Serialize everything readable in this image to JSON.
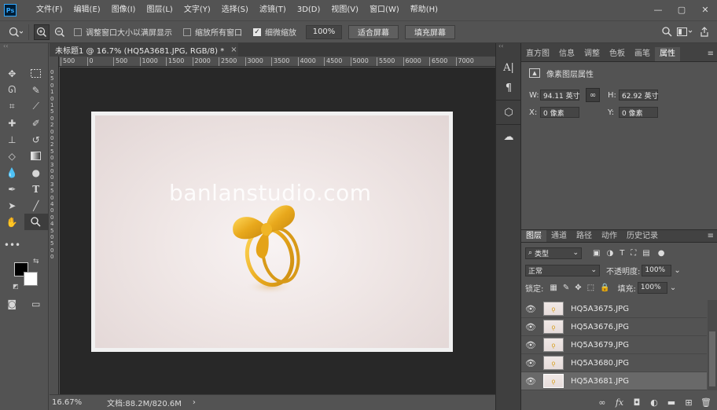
{
  "app": {
    "logo_text": "Ps"
  },
  "menu": [
    "文件(F)",
    "编辑(E)",
    "图像(I)",
    "图层(L)",
    "文字(Y)",
    "选择(S)",
    "滤镜(T)",
    "3D(D)",
    "视图(V)",
    "窗口(W)",
    "帮助(H)"
  ],
  "window_controls": {
    "minimize": "—",
    "maximize": "▢",
    "close": "✕"
  },
  "options": {
    "resize_windows": {
      "label": "调整窗口大小以满屏显示",
      "checked": false
    },
    "zoom_all": {
      "label": "缩放所有窗口",
      "checked": false
    },
    "scrubby_zoom": {
      "label": "细微缩放",
      "checked": true
    },
    "zoom_value": "100%",
    "fit_screen": "适合屏幕",
    "fill_screen": "填充屏幕"
  },
  "document": {
    "tab_title": "未标题1 @ 16.7% (HQ5A3681.JPG, RGB/8) *",
    "tab_close": "×",
    "ruler_h": [
      "500",
      "0",
      "500",
      "1000",
      "1500",
      "2000",
      "2500",
      "3000",
      "3500",
      "4000",
      "4500",
      "5000",
      "5500",
      "6000",
      "6500",
      "7000"
    ],
    "ruler_v": [
      "0",
      "5",
      "0",
      "1",
      "0",
      "1",
      "5",
      "0",
      "2",
      "0",
      "0",
      "2",
      "5",
      "0",
      "3",
      "0",
      "0",
      "3",
      "5",
      "0",
      "4",
      "0",
      "0",
      "4",
      "5",
      "0",
      "5",
      "0",
      "0"
    ],
    "watermark": "banlanstudio.com"
  },
  "status": {
    "zoom": "16.67%",
    "doc_size": "文档:88.2M/820.6M",
    "arrow": "›"
  },
  "properties_panel": {
    "tabs": [
      "直方图",
      "信息",
      "调整",
      "色板",
      "画笔",
      "属性"
    ],
    "active_tab": "属性",
    "title": "像素图层属性",
    "w_label": "W:",
    "w_value": "94.11 英寸",
    "h_label": "H:",
    "h_value": "62.92 英寸",
    "x_label": "X:",
    "x_value": "0 像素",
    "y_label": "Y:",
    "y_value": "0 像素"
  },
  "layers_panel": {
    "tabs": [
      "图层",
      "通道",
      "路径",
      "动作",
      "历史记录"
    ],
    "active_tab": "图层",
    "filter_kind": "类型",
    "blend_mode": "正常",
    "opacity_label": "不透明度:",
    "opacity_value": "100%",
    "lock_label": "锁定:",
    "fill_label": "填充:",
    "fill_value": "100%",
    "layers": [
      {
        "name": "HQ5A3675.JPG",
        "selected": false
      },
      {
        "name": "HQ5A3676.JPG",
        "selected": false
      },
      {
        "name": "HQ5A3679.JPG",
        "selected": false
      },
      {
        "name": "HQ5A3680.JPG",
        "selected": false
      },
      {
        "name": "HQ5A3681.JPG",
        "selected": true
      }
    ]
  }
}
